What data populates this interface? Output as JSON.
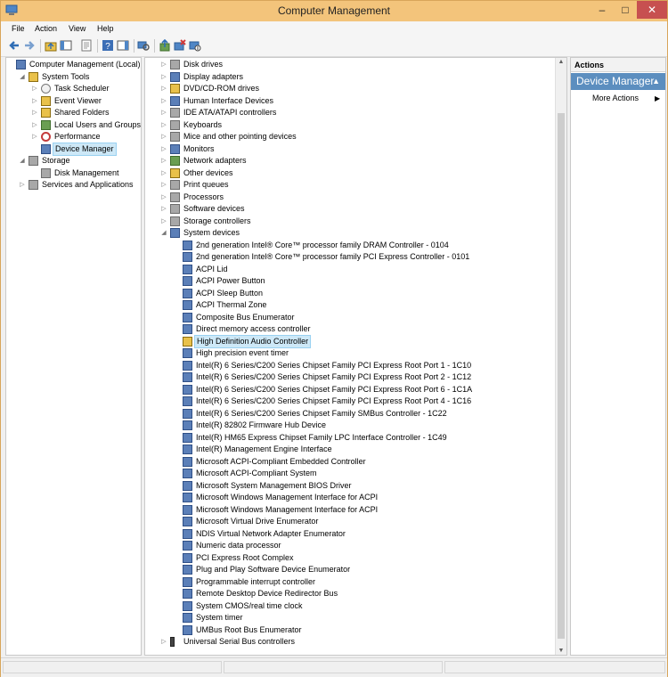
{
  "window": {
    "title": "Computer Management",
    "controls": {
      "minimize": "–",
      "maximize": "□",
      "close": "✕"
    }
  },
  "menu": [
    "File",
    "Action",
    "View",
    "Help"
  ],
  "toolbar": [
    "back-icon",
    "forward-icon",
    "up-folder-icon",
    "show-hide-tree-icon",
    "properties-icon",
    "help-icon",
    "show-hide-action-pane-icon",
    "scan-hardware-icon",
    "update-driver-icon",
    "uninstall-device-icon",
    "disable-device-icon"
  ],
  "left_tree": [
    {
      "label": "Computer Management (Local)",
      "level": 0,
      "expander": "",
      "icon": "computer-icon"
    },
    {
      "label": "System Tools",
      "level": 1,
      "expander": "◢",
      "icon": "tools-icon"
    },
    {
      "label": "Task Scheduler",
      "level": 2,
      "expander": "▷",
      "icon": "clock-icon"
    },
    {
      "label": "Event Viewer",
      "level": 2,
      "expander": "▷",
      "icon": "event-viewer-icon"
    },
    {
      "label": "Shared Folders",
      "level": 2,
      "expander": "▷",
      "icon": "shared-folder-icon"
    },
    {
      "label": "Local Users and Groups",
      "level": 2,
      "expander": "▷",
      "icon": "users-icon"
    },
    {
      "label": "Performance",
      "level": 2,
      "expander": "▷",
      "icon": "performance-icon"
    },
    {
      "label": "Device Manager",
      "level": 2,
      "expander": "",
      "icon": "device-manager-icon",
      "selected": true
    },
    {
      "label": "Storage",
      "level": 1,
      "expander": "◢",
      "icon": "storage-icon"
    },
    {
      "label": "Disk Management",
      "level": 2,
      "expander": "",
      "icon": "disk-icon"
    },
    {
      "label": "Services and Applications",
      "level": 1,
      "expander": "▷",
      "icon": "services-icon"
    }
  ],
  "device_tree": [
    {
      "label": "Disk drives",
      "level": 0,
      "expander": "▷",
      "icon": "disk-drive-icon"
    },
    {
      "label": "Display adapters",
      "level": 0,
      "expander": "▷",
      "icon": "display-adapter-icon"
    },
    {
      "label": "DVD/CD-ROM drives",
      "level": 0,
      "expander": "▷",
      "icon": "dvd-drive-icon"
    },
    {
      "label": "Human Interface Devices",
      "level": 0,
      "expander": "▷",
      "icon": "hid-icon"
    },
    {
      "label": "IDE ATA/ATAPI controllers",
      "level": 0,
      "expander": "▷",
      "icon": "ide-controller-icon"
    },
    {
      "label": "Keyboards",
      "level": 0,
      "expander": "▷",
      "icon": "keyboard-icon"
    },
    {
      "label": "Mice and other pointing devices",
      "level": 0,
      "expander": "▷",
      "icon": "mouse-icon"
    },
    {
      "label": "Monitors",
      "level": 0,
      "expander": "▷",
      "icon": "monitor-icon"
    },
    {
      "label": "Network adapters",
      "level": 0,
      "expander": "▷",
      "icon": "network-adapter-icon"
    },
    {
      "label": "Other devices",
      "level": 0,
      "expander": "▷",
      "icon": "other-devices-icon"
    },
    {
      "label": "Print queues",
      "level": 0,
      "expander": "▷",
      "icon": "printer-icon"
    },
    {
      "label": "Processors",
      "level": 0,
      "expander": "▷",
      "icon": "processor-icon"
    },
    {
      "label": "Software devices",
      "level": 0,
      "expander": "▷",
      "icon": "software-device-icon"
    },
    {
      "label": "Storage controllers",
      "level": 0,
      "expander": "▷",
      "icon": "storage-controller-icon"
    },
    {
      "label": "System devices",
      "level": 0,
      "expander": "◢",
      "icon": "system-devices-icon"
    },
    {
      "label": "2nd generation Intel® Core™ processor family DRAM Controller - 0104",
      "level": 1,
      "icon": "system-device-icon"
    },
    {
      "label": "2nd generation Intel® Core™ processor family PCI Express Controller - 0101",
      "level": 1,
      "icon": "system-device-icon"
    },
    {
      "label": "ACPI Lid",
      "level": 1,
      "icon": "system-device-icon"
    },
    {
      "label": "ACPI Power Button",
      "level": 1,
      "icon": "system-device-icon"
    },
    {
      "label": "ACPI Sleep Button",
      "level": 1,
      "icon": "system-device-icon"
    },
    {
      "label": "ACPI Thermal Zone",
      "level": 1,
      "icon": "system-device-icon"
    },
    {
      "label": "Composite Bus Enumerator",
      "level": 1,
      "icon": "system-device-icon"
    },
    {
      "label": "Direct memory access controller",
      "level": 1,
      "icon": "system-device-icon"
    },
    {
      "label": "High Definition Audio Controller",
      "level": 1,
      "icon": "warning-device-icon",
      "selected": true
    },
    {
      "label": "High precision event timer",
      "level": 1,
      "icon": "system-device-icon"
    },
    {
      "label": "Intel(R) 6 Series/C200 Series Chipset Family PCI Express Root Port 1 - 1C10",
      "level": 1,
      "icon": "system-device-icon"
    },
    {
      "label": "Intel(R) 6 Series/C200 Series Chipset Family PCI Express Root Port 2 - 1C12",
      "level": 1,
      "icon": "system-device-icon"
    },
    {
      "label": "Intel(R) 6 Series/C200 Series Chipset Family PCI Express Root Port 6 - 1C1A",
      "level": 1,
      "icon": "system-device-icon"
    },
    {
      "label": "Intel(R) 6 Series/C200 Series Chipset Family PCI Express Root Port 4 - 1C16",
      "level": 1,
      "icon": "system-device-icon"
    },
    {
      "label": "Intel(R) 6 Series/C200 Series Chipset Family SMBus Controller - 1C22",
      "level": 1,
      "icon": "system-device-icon"
    },
    {
      "label": "Intel(R) 82802 Firmware Hub Device",
      "level": 1,
      "icon": "system-device-icon"
    },
    {
      "label": "Intel(R) HM65 Express Chipset Family LPC Interface Controller - 1C49",
      "level": 1,
      "icon": "system-device-icon"
    },
    {
      "label": "Intel(R) Management Engine Interface",
      "level": 1,
      "icon": "system-device-icon"
    },
    {
      "label": "Microsoft ACPI-Compliant Embedded Controller",
      "level": 1,
      "icon": "system-device-icon"
    },
    {
      "label": "Microsoft ACPI-Compliant System",
      "level": 1,
      "icon": "system-device-icon"
    },
    {
      "label": "Microsoft System Management BIOS Driver",
      "level": 1,
      "icon": "system-device-icon"
    },
    {
      "label": "Microsoft Windows Management Interface for ACPI",
      "level": 1,
      "icon": "system-device-icon"
    },
    {
      "label": "Microsoft Windows Management Interface for ACPI",
      "level": 1,
      "icon": "system-device-icon"
    },
    {
      "label": "Microsoft Virtual Drive Enumerator",
      "level": 1,
      "icon": "system-device-icon"
    },
    {
      "label": "NDIS Virtual Network Adapter Enumerator",
      "level": 1,
      "icon": "system-device-icon"
    },
    {
      "label": "Numeric data processor",
      "level": 1,
      "icon": "system-device-icon"
    },
    {
      "label": "PCI Express Root Complex",
      "level": 1,
      "icon": "system-device-icon"
    },
    {
      "label": "Plug and Play Software Device Enumerator",
      "level": 1,
      "icon": "system-device-icon"
    },
    {
      "label": "Programmable interrupt controller",
      "level": 1,
      "icon": "system-device-icon"
    },
    {
      "label": "Remote Desktop Device Redirector Bus",
      "level": 1,
      "icon": "system-device-icon"
    },
    {
      "label": "System CMOS/real time clock",
      "level": 1,
      "icon": "system-device-icon"
    },
    {
      "label": "System timer",
      "level": 1,
      "icon": "system-device-icon"
    },
    {
      "label": "UMBus Root Bus Enumerator",
      "level": 1,
      "icon": "system-device-icon"
    },
    {
      "label": "Universal Serial Bus controllers",
      "level": 0,
      "expander": "▷",
      "icon": "usb-icon"
    }
  ],
  "actions": {
    "header": "Actions",
    "section": "Device Manager",
    "more": "More Actions"
  },
  "colors": {
    "titlebar": "#f3c47b",
    "selection": "#cde8f7",
    "action_section": "#5c8ebf"
  }
}
